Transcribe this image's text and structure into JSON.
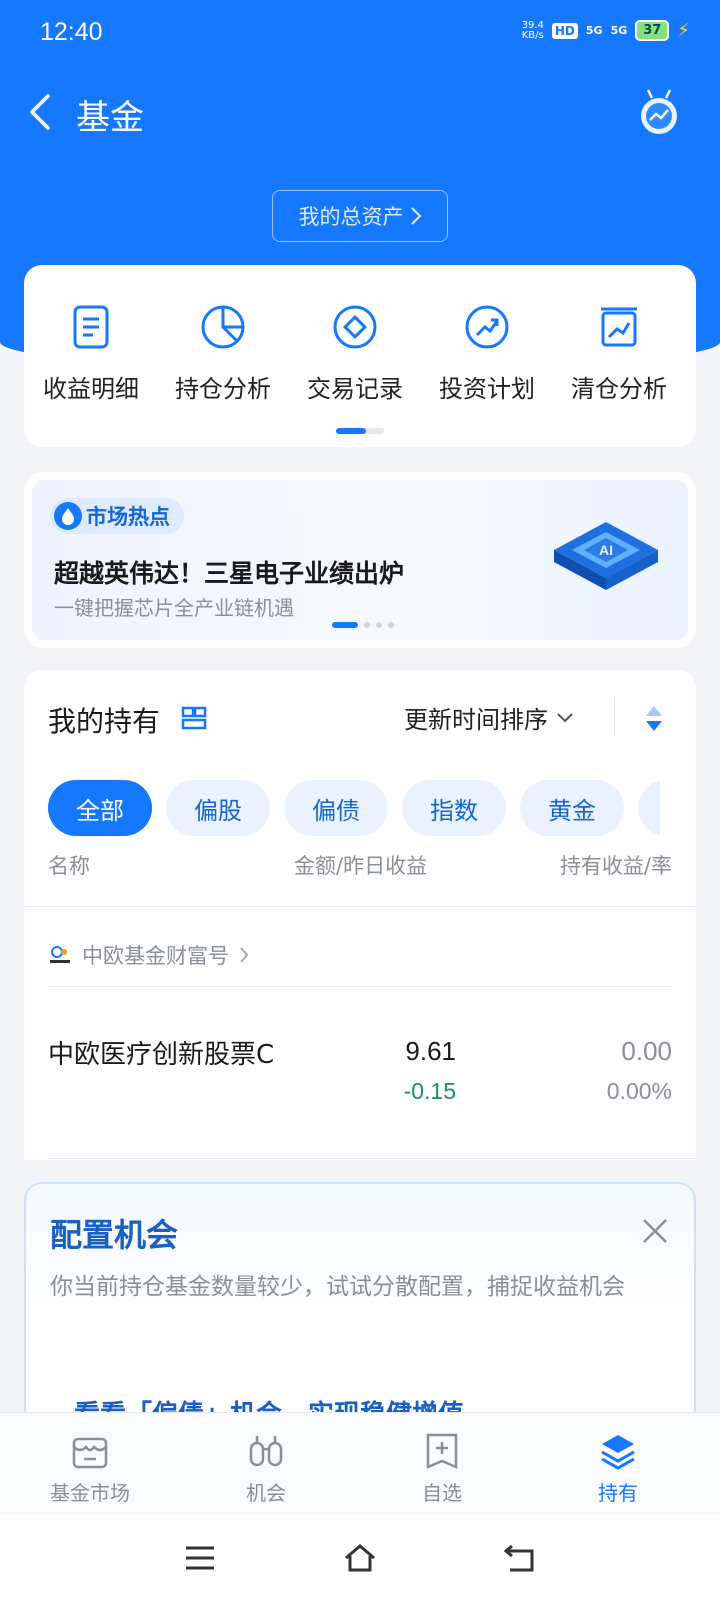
{
  "status_bar": {
    "time": "12:40",
    "net_speed_value": "39.4",
    "net_speed_unit": "KB/s",
    "hd_label": "HD",
    "signal1": "5G",
    "signal2": "5G",
    "battery": "37"
  },
  "nav": {
    "title": "基金",
    "back_icon": "chevron-left-icon",
    "assistant_icon": "robot-assistant-icon"
  },
  "assets_button": {
    "label": "我的总资产"
  },
  "tools": [
    {
      "label": "收益明细",
      "icon": "document-icon"
    },
    {
      "label": "持仓分析",
      "icon": "pie-chart-icon"
    },
    {
      "label": "交易记录",
      "icon": "diamond-icon"
    },
    {
      "label": "投资计划",
      "icon": "trend-up-icon"
    },
    {
      "label": "清仓分析",
      "icon": "chart-frame-icon"
    }
  ],
  "market_hot": {
    "tag": "市场热点",
    "title": "超越英伟达！三星电子业绩出炉",
    "subtitle": "一键把握芯片全产业链机遇",
    "chip_text": "AI"
  },
  "holdings": {
    "title": "我的持有",
    "sort_label": "更新时间排序",
    "filters": [
      "全部",
      "偏股",
      "偏债",
      "指数",
      "黄金"
    ],
    "columns": {
      "name": "名称",
      "amount": "金额/昨日收益",
      "profit": "持有收益/率"
    },
    "company": "中欧基金财富号",
    "fund": {
      "name": "中欧医疗创新股票C",
      "amount": "9.61",
      "yesterday": "-0.15",
      "holding_profit": "0.00",
      "holding_rate": "0.00%"
    }
  },
  "config": {
    "title": "配置机会",
    "description": "你当前持仓基金数量较少，试试分散配置，捕捉收益机会",
    "inner_text": "看看「偏债」机会，实现稳健增值"
  },
  "tabbar": [
    {
      "label": "基金市场",
      "icon": "store-icon",
      "active": false
    },
    {
      "label": "机会",
      "icon": "binoculars-icon",
      "active": false
    },
    {
      "label": "自选",
      "icon": "add-box-icon",
      "active": false
    },
    {
      "label": "持有",
      "icon": "layers-icon",
      "active": true
    }
  ],
  "colors": {
    "primary": "#1677ff",
    "negative": "#14935f",
    "muted": "#8a8f99"
  }
}
